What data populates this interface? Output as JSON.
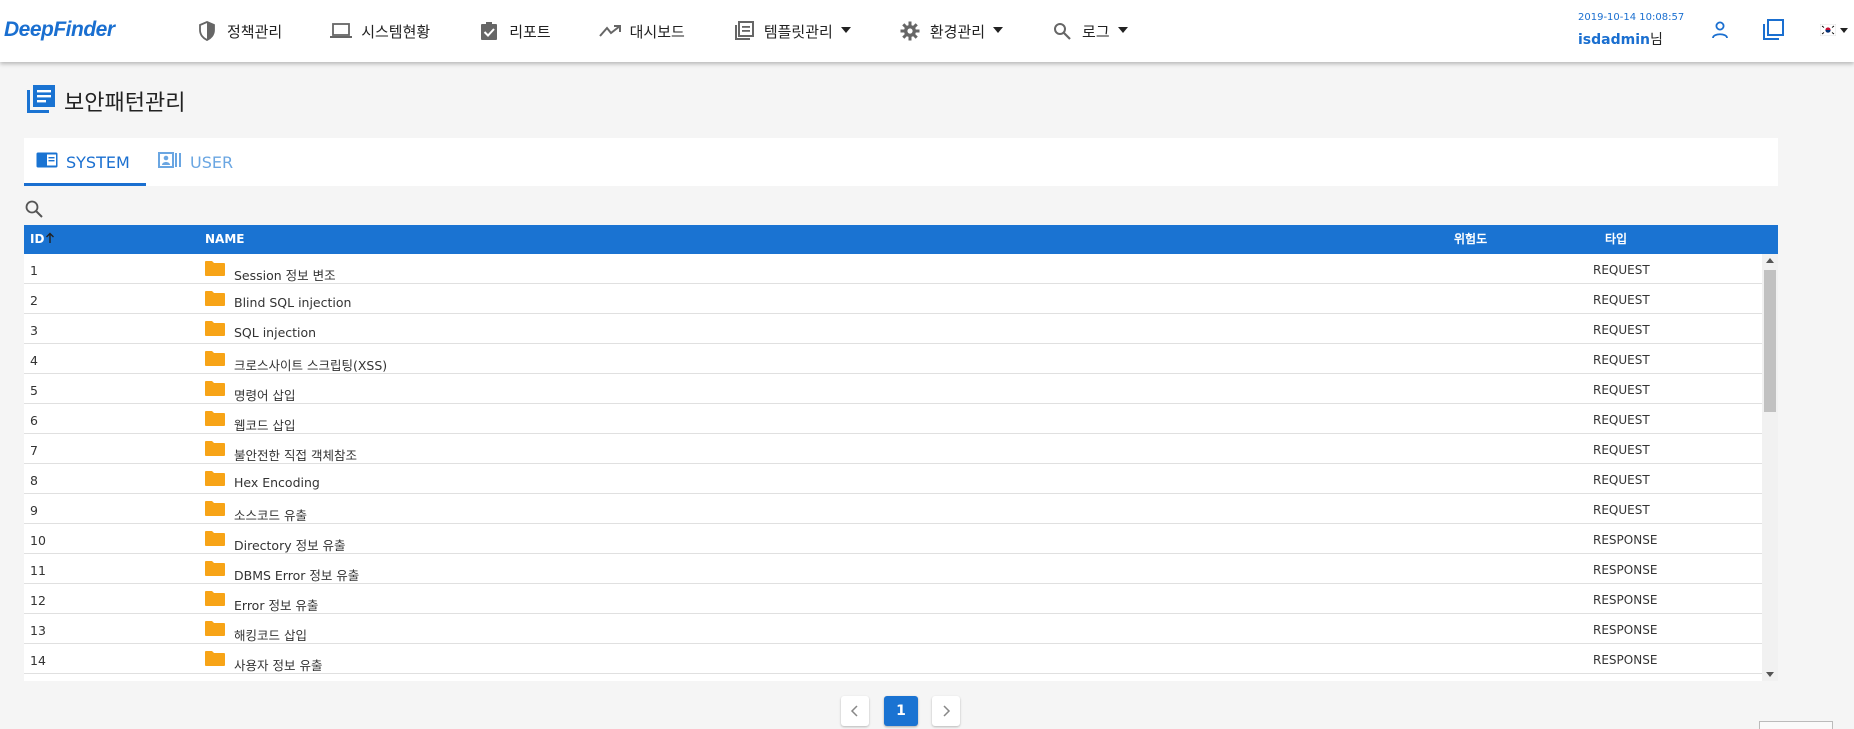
{
  "app": {
    "logo": "DeepFinder"
  },
  "nav": {
    "items": [
      {
        "label": "정책관리",
        "icon": "shield-icon",
        "dropdown": false
      },
      {
        "label": "시스템현황",
        "icon": "laptop-icon",
        "dropdown": false
      },
      {
        "label": "리포트",
        "icon": "clipboard-check-icon",
        "dropdown": false
      },
      {
        "label": "대시보드",
        "icon": "trend-icon",
        "dropdown": false
      },
      {
        "label": "템플릿관리",
        "icon": "library-books-icon",
        "dropdown": true
      },
      {
        "label": "환경관리",
        "icon": "gear-icon",
        "dropdown": true
      },
      {
        "label": "로그",
        "icon": "search-icon",
        "dropdown": true
      }
    ]
  },
  "header": {
    "datetime": "2019-10-14 10:08:57",
    "username": "isdadmin",
    "username_suffix": "님"
  },
  "page": {
    "title": "보안패턴관리"
  },
  "tabs": [
    {
      "label": "SYSTEM",
      "icon": "book-icon",
      "active": true
    },
    {
      "label": "USER",
      "icon": "contact-list-icon",
      "active": false
    }
  ],
  "table": {
    "columns": {
      "id": "ID",
      "name": "NAME",
      "risk": "위험도",
      "type": "타입"
    },
    "sort": {
      "column": "ID",
      "direction": "ascending"
    },
    "rows": [
      {
        "id": "1",
        "name": "Session 정보 변조",
        "type": "REQUEST"
      },
      {
        "id": "2",
        "name": "Blind SQL injection",
        "type": "REQUEST"
      },
      {
        "id": "3",
        "name": "SQL injection",
        "type": "REQUEST"
      },
      {
        "id": "4",
        "name": "크로스사이트 스크립팅(XSS)",
        "type": "REQUEST"
      },
      {
        "id": "5",
        "name": "명령어 삽입",
        "type": "REQUEST"
      },
      {
        "id": "6",
        "name": "웹코드 삽입",
        "type": "REQUEST"
      },
      {
        "id": "7",
        "name": "불안전한 직접 객체참조",
        "type": "REQUEST"
      },
      {
        "id": "8",
        "name": "Hex Encoding",
        "type": "REQUEST"
      },
      {
        "id": "9",
        "name": "소스코드 유출",
        "type": "REQUEST"
      },
      {
        "id": "10",
        "name": "Directory 정보 유출",
        "type": "RESPONSE"
      },
      {
        "id": "11",
        "name": "DBMS Error 정보 유출",
        "type": "RESPONSE"
      },
      {
        "id": "12",
        "name": "Error 정보 유출",
        "type": "RESPONSE"
      },
      {
        "id": "13",
        "name": "해킹코드 삽입",
        "type": "RESPONSE"
      },
      {
        "id": "14",
        "name": "사용자 정보 유출",
        "type": "RESPONSE"
      }
    ]
  },
  "pagination": {
    "current": "1"
  },
  "colors": {
    "primary": "#1a73d2",
    "folder": "#f7a417",
    "tab_inactive": "#6aa6e2"
  }
}
